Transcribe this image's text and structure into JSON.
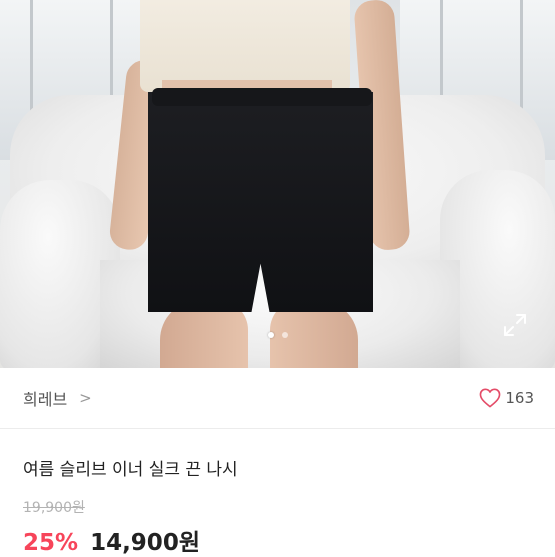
{
  "product": {
    "gallery": {
      "image_alt": "black shorts on model",
      "page_dots": 2,
      "active_dot": 1,
      "expand_icon": "expand-icon"
    },
    "seller": {
      "name": "희레브",
      "chevron": ">"
    },
    "likes": {
      "icon": "heart-icon",
      "count": "163",
      "color": "#e44c68"
    },
    "title": "여름 슬리브 이너 실크 끈 나시",
    "original_price": "19,900원",
    "discount_percent": "25%",
    "discount_color": "#f7455a",
    "price": "14,900원"
  }
}
